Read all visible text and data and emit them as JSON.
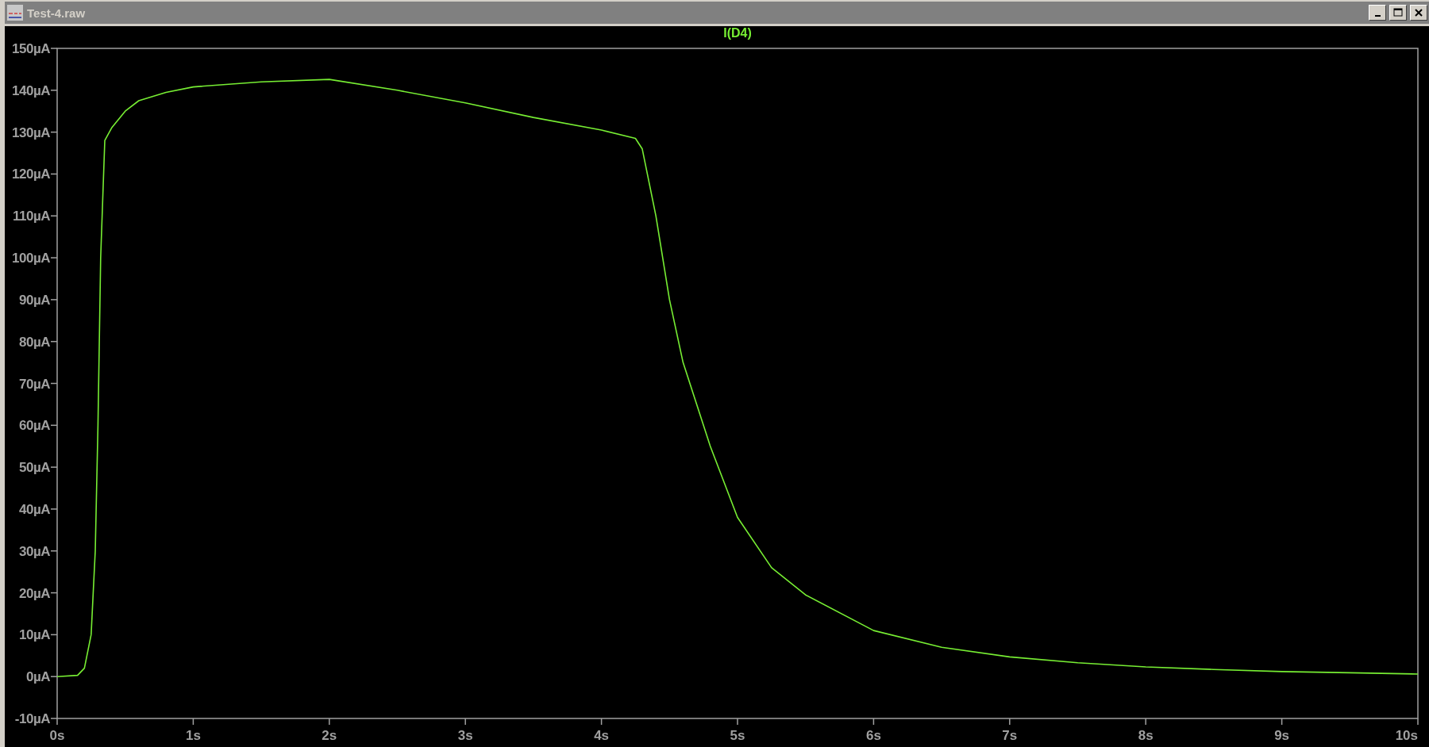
{
  "window": {
    "title": "Test-4.raw"
  },
  "plot": {
    "chart_data": {
      "type": "line",
      "x": [
        0,
        0.15,
        0.2,
        0.25,
        0.28,
        0.3,
        0.32,
        0.35,
        0.4,
        0.5,
        0.6,
        0.8,
        1.0,
        1.5,
        2.0,
        2.5,
        3.0,
        3.5,
        4.0,
        4.25,
        4.3,
        4.4,
        4.5,
        4.6,
        4.8,
        5.0,
        5.25,
        5.5,
        6.0,
        6.5,
        7.0,
        7.5,
        8.0,
        8.5,
        9.0,
        9.5,
        10
      ],
      "series": [
        {
          "name": "I(D4)",
          "color": "#77ee33",
          "values": [
            0,
            0.3,
            2,
            10,
            30,
            60,
            100,
            128,
            131,
            135,
            137.5,
            139.5,
            140.8,
            142,
            142.6,
            140,
            137,
            133.5,
            130.5,
            128.5,
            126,
            110,
            90,
            75,
            55,
            38,
            26,
            19.5,
            11,
            7,
            4.7,
            3.3,
            2.3,
            1.7,
            1.2,
            0.9,
            0.6
          ]
        }
      ],
      "xlim": [
        0,
        10
      ],
      "ylim": [
        -10,
        150
      ],
      "xticks": [
        {
          "value": 0,
          "label": "0s"
        },
        {
          "value": 1,
          "label": "1s"
        },
        {
          "value": 2,
          "label": "2s"
        },
        {
          "value": 3,
          "label": "3s"
        },
        {
          "value": 4,
          "label": "4s"
        },
        {
          "value": 5,
          "label": "5s"
        },
        {
          "value": 6,
          "label": "6s"
        },
        {
          "value": 7,
          "label": "7s"
        },
        {
          "value": 8,
          "label": "8s"
        },
        {
          "value": 9,
          "label": "9s"
        },
        {
          "value": 10,
          "label": "10s"
        }
      ],
      "yticks": [
        {
          "value": 150,
          "label": "150µA"
        },
        {
          "value": 140,
          "label": "140µA"
        },
        {
          "value": 130,
          "label": "130µA"
        },
        {
          "value": 120,
          "label": "120µA"
        },
        {
          "value": 110,
          "label": "110µA"
        },
        {
          "value": 100,
          "label": "100µA"
        },
        {
          "value": 90,
          "label": "90µA"
        },
        {
          "value": 80,
          "label": "80µA"
        },
        {
          "value": 70,
          "label": "70µA"
        },
        {
          "value": 60,
          "label": "60µA"
        },
        {
          "value": 50,
          "label": "50µA"
        },
        {
          "value": 40,
          "label": "40µA"
        },
        {
          "value": 30,
          "label": "30µA"
        },
        {
          "value": 20,
          "label": "20µA"
        },
        {
          "value": 10,
          "label": "10µA"
        },
        {
          "value": 0,
          "label": "0µA"
        },
        {
          "value": -10,
          "label": "-10µA"
        }
      ]
    }
  }
}
